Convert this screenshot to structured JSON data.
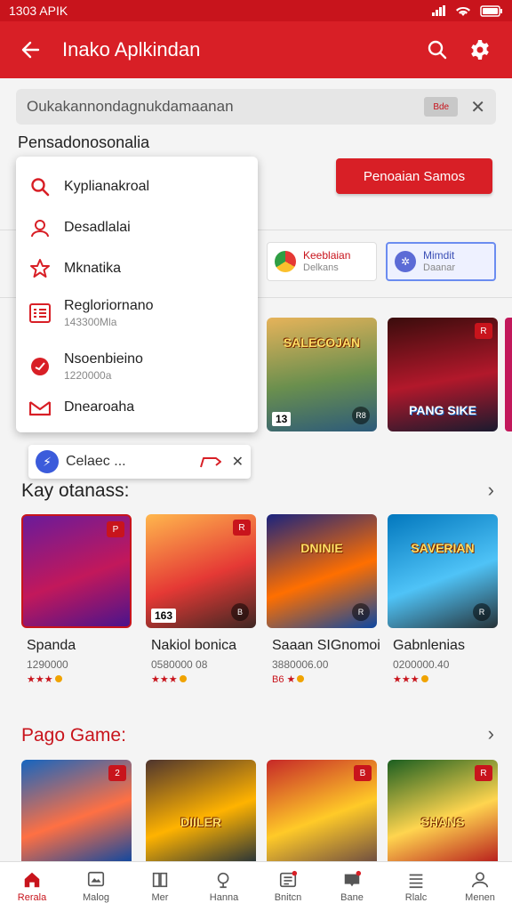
{
  "status": {
    "time": "1303 APIK"
  },
  "appbar": {
    "title": "Inako Aplkindan"
  },
  "search": {
    "value": "Oukakannondagnukdamaanan",
    "chip": "Bde"
  },
  "section_label": "Pensadonosonalia",
  "red_button": "Penoaian Samos",
  "chips": [
    {
      "title": "Keeblaian",
      "sub": "Delkans",
      "color": "#2f9e44"
    },
    {
      "title": "Mimdit",
      "sub": "Daanar",
      "color": "#4c6ef5"
    }
  ],
  "dropdown": [
    {
      "label": "Kyplianakroal",
      "icon": "search-icon"
    },
    {
      "label": "Desadlalai",
      "icon": "person-icon"
    },
    {
      "label": "Mknatika",
      "icon": "star-icon"
    },
    {
      "label": "Regloriornano",
      "sub": "143300Mla",
      "icon": "list-icon"
    },
    {
      "label": "Nsoenbieino",
      "sub": "1220000a",
      "icon": "red-circle-icon"
    },
    {
      "label": "Dnearoaha",
      "icon": "inbox-icon"
    }
  ],
  "toast": {
    "text": "Celaec ..."
  },
  "section1": {
    "title": "Kay otanass:"
  },
  "section2": {
    "title": "Pago Game:"
  },
  "top_tiles": [
    {
      "logo": "SALECOJAN",
      "num": "13",
      "bottom": "R8",
      "colors": [
        "#e6b35a",
        "#6a8f4e",
        "#2c5a7a"
      ]
    },
    {
      "logo": "PANG SIKE",
      "top": "R",
      "colors": [
        "#3a0c0c",
        "#b2182b",
        "#1a1a2e"
      ]
    }
  ],
  "games": [
    {
      "name": "Spanda",
      "sub": "1290000",
      "rating": "★★★",
      "top": "P",
      "colors": [
        "#6a1b9a",
        "#c2185b",
        "#4a148c"
      ]
    },
    {
      "name": "Nakiol bonica",
      "sub": "0580000 08",
      "rating": "★★★",
      "num": "163",
      "bottom": "B",
      "top": "R",
      "colors": [
        "#ffb74d",
        "#e53935",
        "#3e2723"
      ]
    },
    {
      "name": "Saaan SIGnomoi",
      "sub": "3880006.00",
      "rating": "B6 ★",
      "logo": "DNINIE",
      "bottom": "R",
      "colors": [
        "#1a237e",
        "#ff6f00",
        "#0d47a1"
      ]
    },
    {
      "name": "Gabnlenias",
      "sub": "0200000.40",
      "rating": "★★★",
      "logo": "SAVERIAN",
      "bottom": "R",
      "colors": [
        "#0277bd",
        "#4fc3f7",
        "#263238"
      ]
    }
  ],
  "bottom_tiles": [
    {
      "top": "2",
      "colors": [
        "#1565c0",
        "#ff7043",
        "#0d47a1"
      ]
    },
    {
      "logo": "DIILER",
      "colors": [
        "#4e342e",
        "#ffb300",
        "#263238"
      ]
    },
    {
      "top": "B",
      "colors": [
        "#c62828",
        "#ffca28",
        "#6d4c41"
      ]
    },
    {
      "logo": "SHANS",
      "top": "R",
      "colors": [
        "#1b5e20",
        "#ffd54f",
        "#b71c1c"
      ]
    }
  ],
  "nav": [
    {
      "label": "Rerala",
      "icon": "home-icon",
      "active": true
    },
    {
      "label": "Malog",
      "icon": "gallery-icon"
    },
    {
      "label": "Mer",
      "icon": "book-icon"
    },
    {
      "label": "Hanna",
      "icon": "search-icon"
    },
    {
      "label": "Bnitcn",
      "icon": "list-icon"
    },
    {
      "label": "Bane",
      "icon": "tray-icon"
    },
    {
      "label": "Rlalc",
      "icon": "stack-icon"
    },
    {
      "label": "Menen",
      "icon": "profile-icon"
    }
  ]
}
